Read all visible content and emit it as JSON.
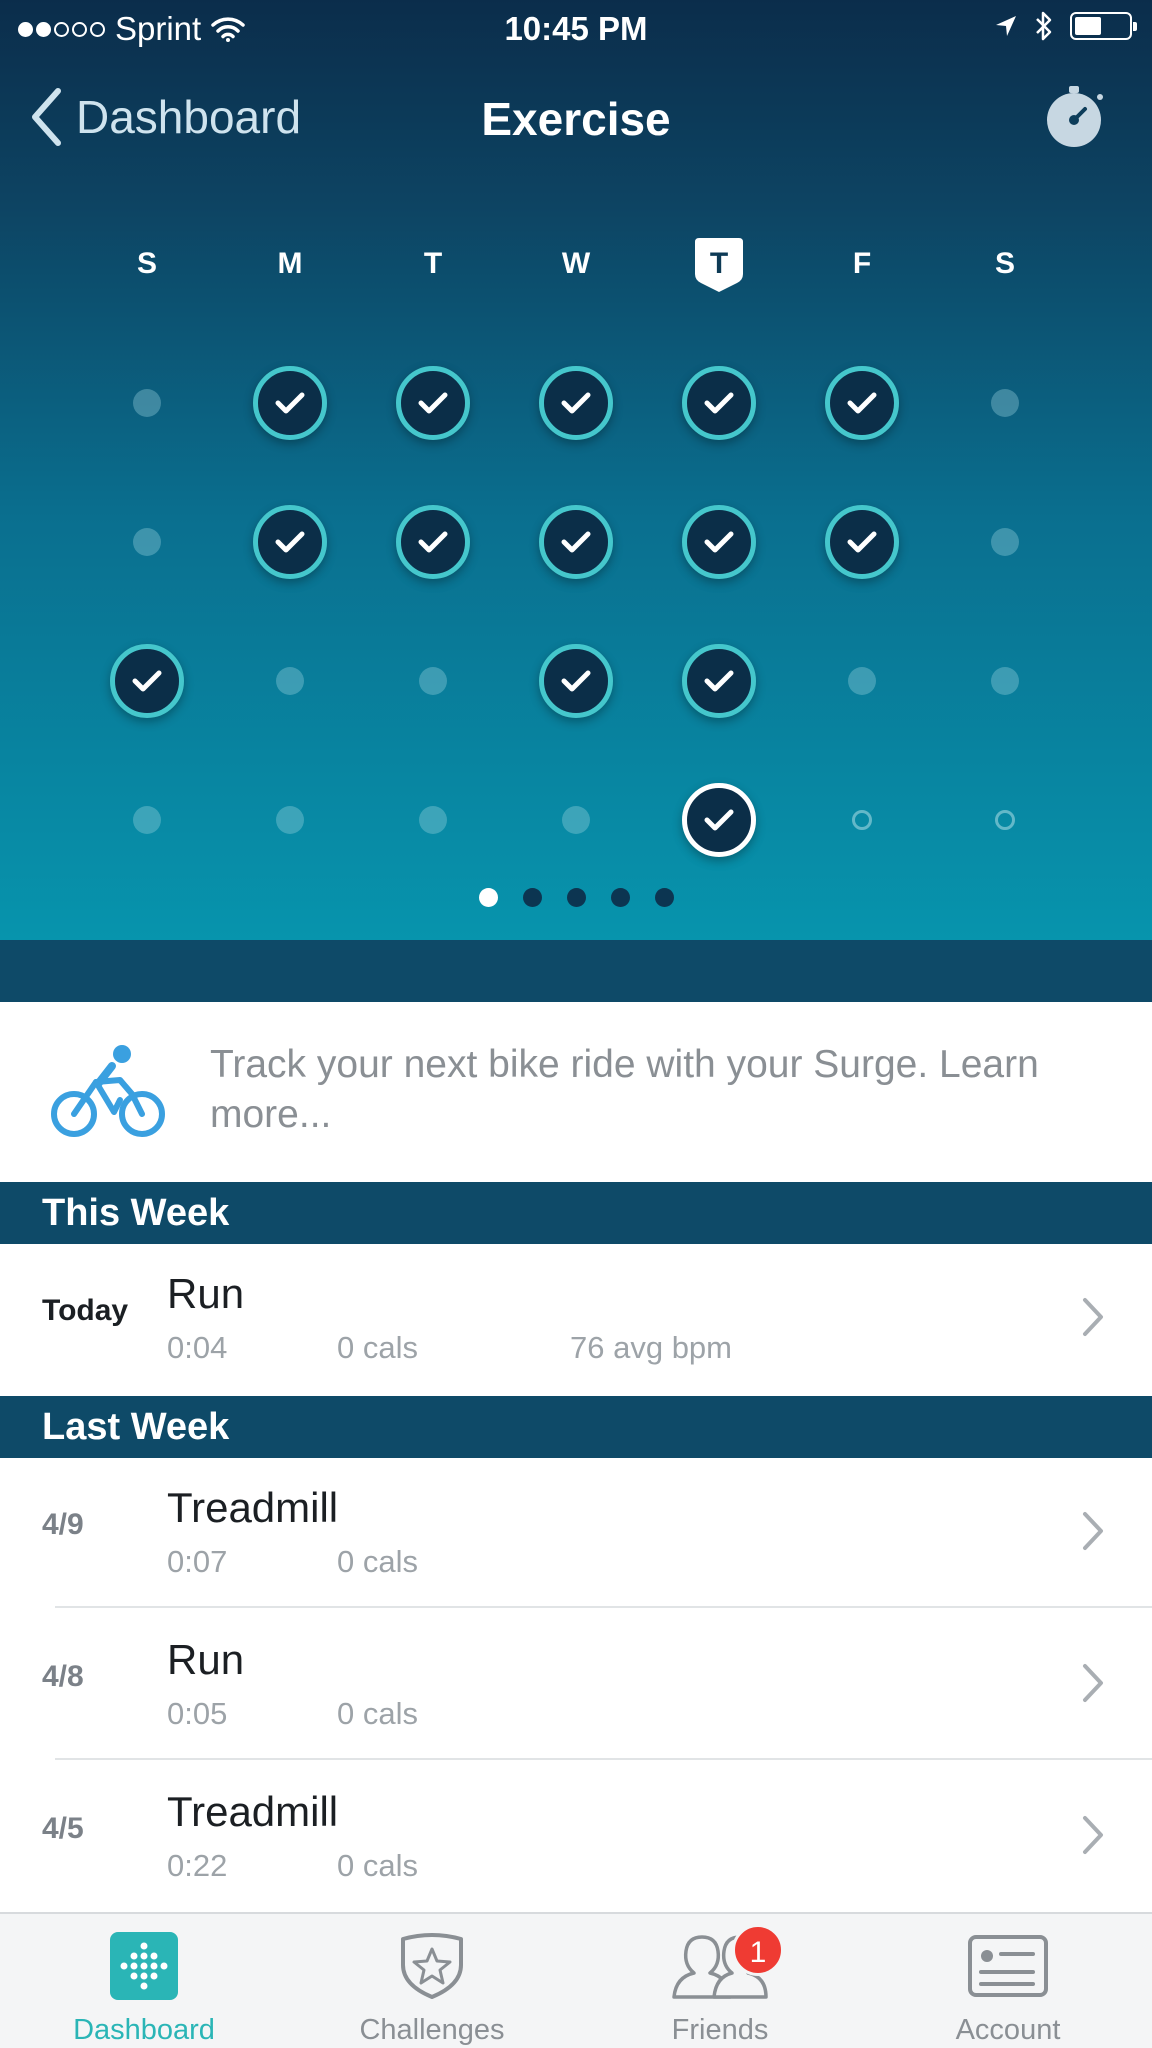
{
  "status_bar": {
    "carrier": "Sprint",
    "signal_bars": 2,
    "time": "10:45 PM"
  },
  "nav": {
    "back_label": "Dashboard",
    "title": "Exercise",
    "timer_icon": "stopwatch-icon"
  },
  "calendar": {
    "days": [
      {
        "label": "S",
        "today": false
      },
      {
        "label": "M",
        "today": false
      },
      {
        "label": "T",
        "today": false
      },
      {
        "label": "W",
        "today": false
      },
      {
        "label": "T",
        "today": true
      },
      {
        "label": "F",
        "today": false
      },
      {
        "label": "S",
        "today": false
      }
    ],
    "weeks": [
      [
        "none",
        "done",
        "done",
        "done",
        "done",
        "done",
        "none"
      ],
      [
        "none",
        "done",
        "done",
        "done",
        "done",
        "done",
        "none"
      ],
      [
        "done",
        "none",
        "none",
        "done",
        "done",
        "none",
        "none"
      ],
      [
        "none",
        "none",
        "none",
        "none",
        "current",
        "future",
        "future"
      ]
    ],
    "page_count": 5,
    "active_page": 0
  },
  "promo": {
    "icon": "bike-icon",
    "text": "Track your next bike ride with your Surge. Learn more..."
  },
  "sections": [
    {
      "title": "This Week",
      "items": [
        {
          "date": "Today",
          "name": "Run",
          "duration": "0:04",
          "calories": "0 cals",
          "heart_rate": "76 avg bpm"
        }
      ]
    },
    {
      "title": "Last Week",
      "items": [
        {
          "date": "4/9",
          "name": "Treadmill",
          "duration": "0:07",
          "calories": "0 cals"
        },
        {
          "date": "4/8",
          "name": "Run",
          "duration": "0:05",
          "calories": "0 cals"
        },
        {
          "date": "4/5",
          "name": "Treadmill",
          "duration": "0:22",
          "calories": "0 cals"
        }
      ]
    }
  ],
  "tabbar": {
    "tabs": [
      {
        "label": "Dashboard",
        "icon": "dashboard-icon",
        "active": true
      },
      {
        "label": "Challenges",
        "icon": "challenges-icon",
        "active": false
      },
      {
        "label": "Friends",
        "icon": "friends-icon",
        "active": false,
        "badge": "1"
      },
      {
        "label": "Account",
        "icon": "account-icon",
        "active": false
      }
    ]
  },
  "colors": {
    "accent": "#2ab5b6",
    "check_ring": "#45c7cc",
    "section_bg": "#0e4a68",
    "badge": "#ef3b33",
    "bike_icon": "#3aa0e0"
  }
}
